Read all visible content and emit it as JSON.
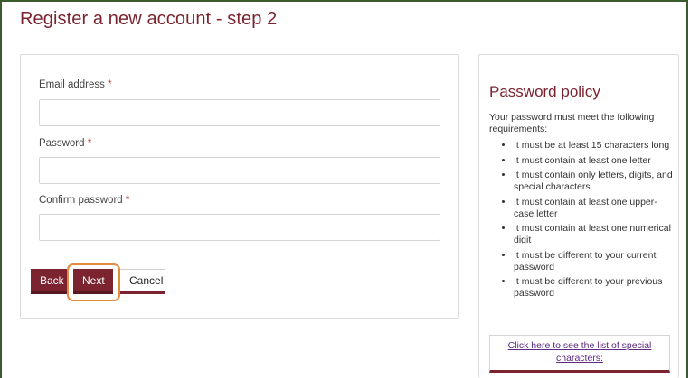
{
  "page": {
    "title": "Register a new account - step 2"
  },
  "form": {
    "email_label": "Email address",
    "password_label": "Password",
    "confirm_label": "Confirm password",
    "required_marker": "*",
    "email_value": "",
    "password_value": "",
    "confirm_value": ""
  },
  "buttons": {
    "back": "Back",
    "next": "Next",
    "cancel": "Cancel"
  },
  "policy": {
    "title": "Password policy",
    "intro": "Your password must meet the following requirements:",
    "rules": [
      "It must be at least 15 characters long",
      "It must contain at least one letter",
      "It must contain only letters, digits, and special characters",
      "It must contain at least one upper-case letter",
      "It must contain at least one numerical digit",
      "It must be different to your current password",
      "It must be different to your previous password"
    ],
    "special_chars_link": "Click here to see the list of special characters:"
  },
  "colors": {
    "brand": "#7b2430",
    "highlight": "#e48a3c",
    "link": "#5b2a82",
    "frame": "#3b5a2e"
  }
}
